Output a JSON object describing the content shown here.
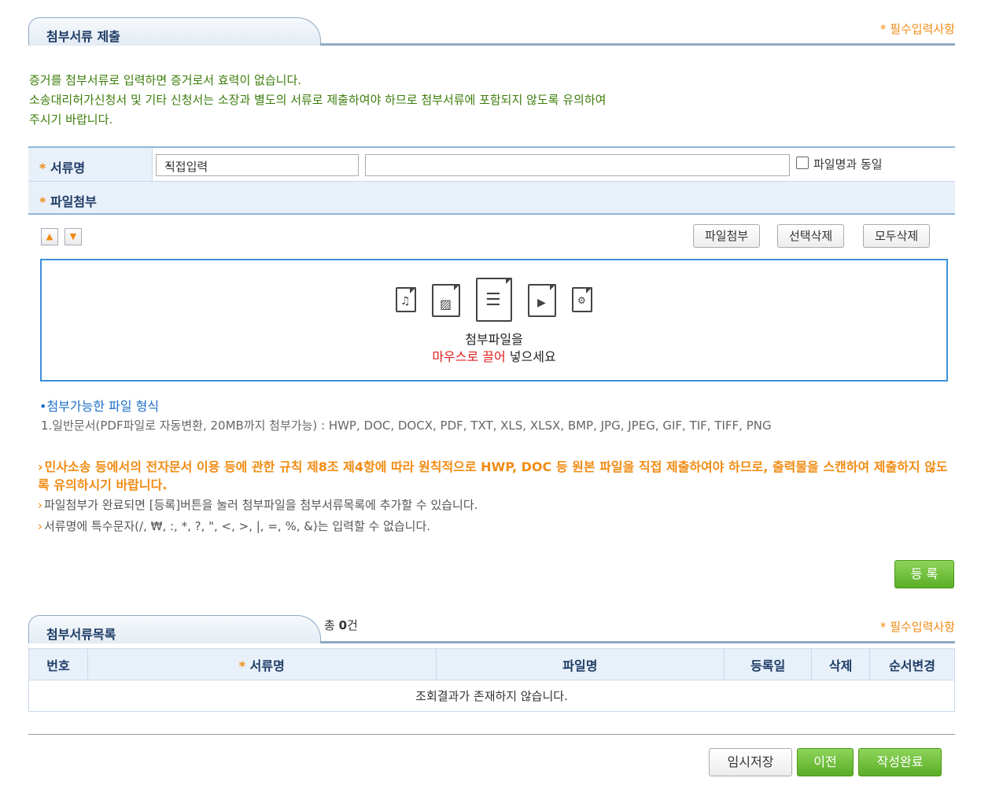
{
  "section1": {
    "title": "첨부서류 제출",
    "required_note": "* 필수입력사항"
  },
  "notice": {
    "line1": "증거를 첨부서류로 입력하면 증거로서 효력이 없습니다.",
    "line2": "소송대리허가신청서 및 기타 신청서는 소장과 별도의 서류로 제출하여야 하므로 첨부서류에 포함되지 않도록 유의하여",
    "line3": "주시기 바랍니다."
  },
  "form": {
    "doc_name_label": "서류명",
    "doc_select_value": "직접입력",
    "doc_name_input_value": "",
    "same_as_file_label": "파일명과 동일",
    "attach_label": "파일첨부",
    "required_mark": "*"
  },
  "toolbar": {
    "attach_button": "파일첨부",
    "delete_selected_button": "선택삭제",
    "delete_all_button": "모두삭제",
    "up_glyph": "▲",
    "down_glyph": "▼"
  },
  "dropzone": {
    "line1": "첨부파일을",
    "line2_red": "마우스로 끌어",
    "line2_rest": " 넣으세요"
  },
  "formats": {
    "title": "첨부가능한 파일 형식",
    "line": "1.일반문서(PDF파일로 자동변환, 20MB까지 첨부가능) : HWP, DOC, DOCX, PDF, TXT, XLS, XLSX, BMP, JPG, JPEG, GIF, TIF, TIFF, PNG"
  },
  "bullets": {
    "orange": "민사소송 등에서의 전자문서 이용 등에 관한 규칙 제8조 제4항에 따라 원칙적으로 HWP, DOC 등 원본 파일을 직접 제출하여야 하므로, 출력물을 스캔하여 제출하지 않도록 유의하시기 바랍니다.",
    "gray1": "파일첨부가 완료되면 [등록]버튼을 눌러 첨부파일을 첨부서류목록에 추가할 수 있습니다.",
    "gray2": "서류명에 특수문자(/, ₩, :, *, ?, \", <, >, |, =, %, &)는 입력할 수 없습니다."
  },
  "register_button": "등 록",
  "section2": {
    "title": "첨부서류목록",
    "required_note": "* 필수입력사항",
    "count_prefix": "총 ",
    "count_value": "0",
    "count_suffix": "건"
  },
  "list": {
    "headers": {
      "no": "번호",
      "doc_name": "서류명",
      "file_name": "파일명",
      "date": "등록일",
      "delete": "삭제",
      "order": "순서변경"
    },
    "empty_message": "조회결과가 존재하지 않습니다."
  },
  "footer": {
    "temp_save": "임시저장",
    "prev": "이전",
    "complete": "작성완료"
  },
  "colors": {
    "accent_orange": "#f08c14",
    "accent_green": "#5aae27",
    "accent_blue": "#3b8fd8"
  }
}
